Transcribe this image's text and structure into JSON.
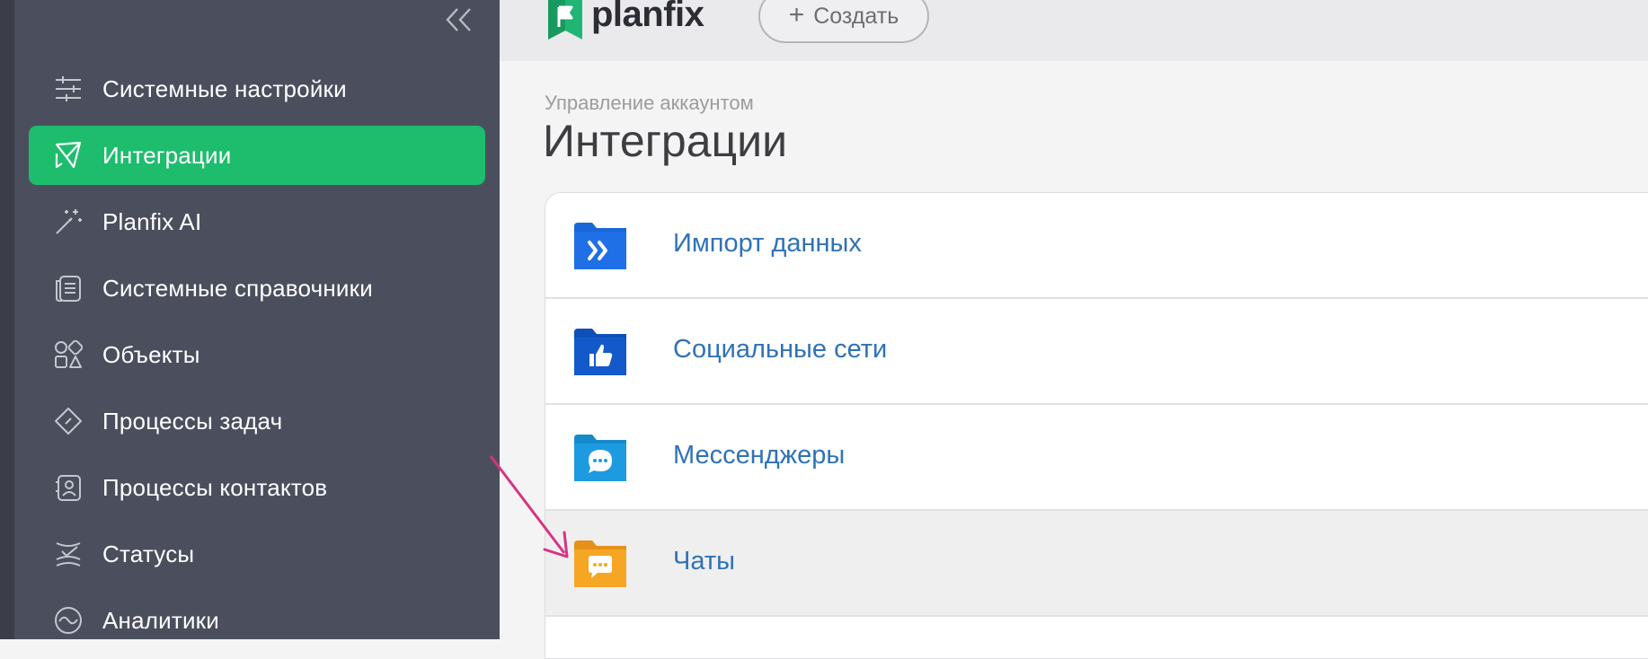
{
  "sidebar": {
    "items": [
      {
        "label": "Системные настройки",
        "icon": "sliders-icon"
      },
      {
        "label": "Интеграции",
        "icon": "paper-plane-icon",
        "active": true
      },
      {
        "label": "Planfix AI",
        "icon": "magic-wand-icon"
      },
      {
        "label": "Системные справочники",
        "icon": "list-document-icon"
      },
      {
        "label": "Объекты",
        "icon": "shapes-icon"
      },
      {
        "label": "Процессы задач",
        "icon": "diamond-process-icon"
      },
      {
        "label": "Процессы контактов",
        "icon": "contact-card-icon"
      },
      {
        "label": "Статусы",
        "icon": "status-check-icon"
      },
      {
        "label": "Аналитики",
        "icon": "analytics-wave-icon"
      }
    ],
    "active_color": "#1ebd6e"
  },
  "header": {
    "logo_text": "planfix",
    "create_label": "Создать"
  },
  "main": {
    "breadcrumb": "Управление аккаунтом",
    "title": "Интеграции",
    "rows": [
      {
        "label": "Импорт данных",
        "icon": "import-folder-icon",
        "color": "#1b66d8"
      },
      {
        "label": "Социальные сети",
        "icon": "social-folder-icon",
        "color": "#1359c9"
      },
      {
        "label": "Мессенджеры",
        "icon": "messenger-folder-icon",
        "color": "#1d9be0"
      },
      {
        "label": "Чаты",
        "icon": "chat-folder-icon",
        "color": "#f5a623",
        "highlighted": true
      }
    ]
  },
  "annotation": {
    "color": "#d63384"
  }
}
